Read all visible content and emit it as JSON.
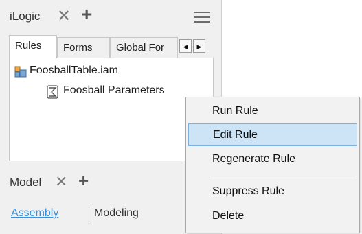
{
  "ilogic_panel": {
    "title": "iLogic",
    "close_glyph": "✕",
    "add_glyph": "+",
    "tabs": [
      "Rules",
      "Forms",
      "Global For"
    ],
    "scroll_left_glyph": "◀",
    "scroll_right_glyph": "▶",
    "tree": {
      "assembly": "FoosballTable.iam",
      "assembly_icon": "assembly-icon",
      "rule": "Foosball Parameters",
      "rule_icon": "rule-icon"
    }
  },
  "model_panel": {
    "title": "Model",
    "close_glyph": "✕",
    "add_glyph": "+",
    "links": [
      "Assembly",
      "Modeling"
    ]
  },
  "context_menu": {
    "items": [
      "Run Rule",
      "Edit Rule",
      "Regenerate Rule",
      "Suppress Rule",
      "Delete"
    ],
    "highlighted": "Edit Rule"
  },
  "colors": {
    "panel_bg": "#f0f0f0",
    "link": "#3b8fd6",
    "highlight_bg": "#cde4f7",
    "highlight_border": "#7fb2e0"
  }
}
